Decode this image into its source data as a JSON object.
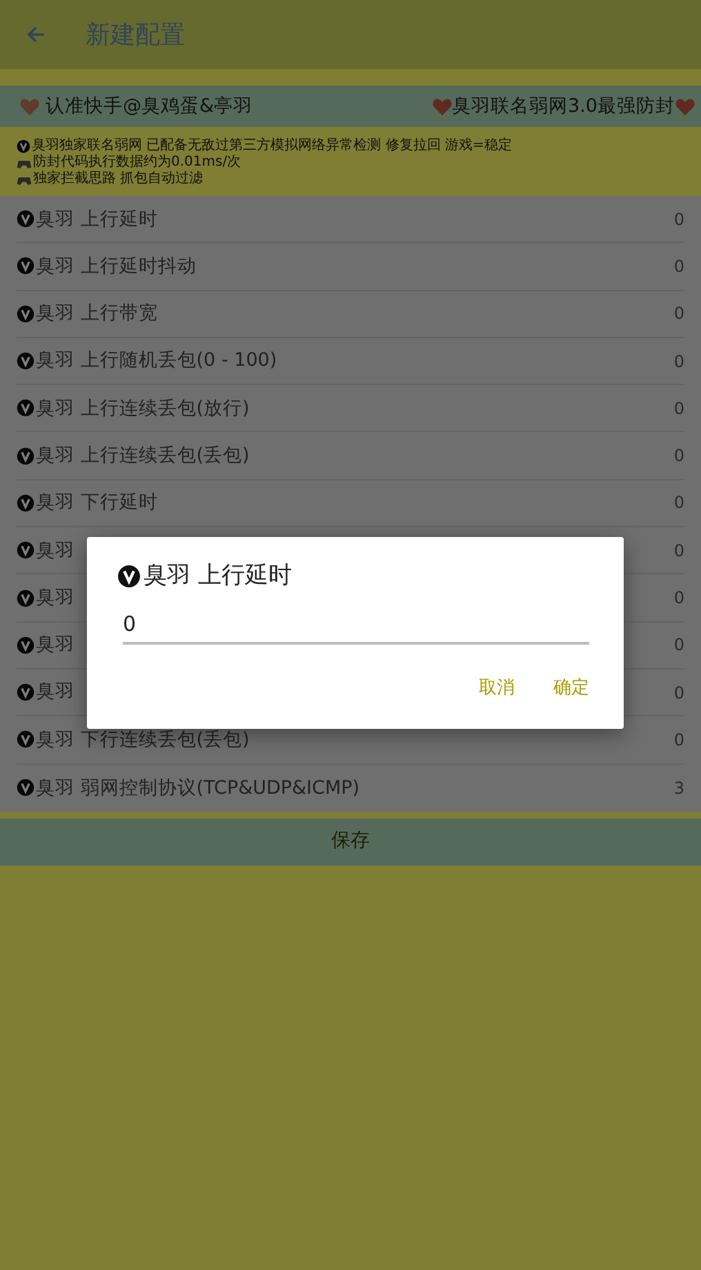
{
  "app_bar": {
    "title": "新建配置"
  },
  "banner": {
    "left": "认准快手@臭鸡蛋&亭羽",
    "right": "臭羽联名弱网3.0最强防封"
  },
  "notice": [
    "臭羽独家联名弱网 已配备无敌过第三方模拟网络异常检测 修复拉回 游戏=稳定",
    "防封代码执行数据约为0.01ms/次",
    "独家拦截思路 抓包自动过滤"
  ],
  "settings": [
    {
      "label": "臭羽 上行延时",
      "value": "0"
    },
    {
      "label": "臭羽 上行延时抖动",
      "value": "0"
    },
    {
      "label": "臭羽 上行带宽",
      "value": "0"
    },
    {
      "label": "臭羽 上行随机丢包(0 - 100)",
      "value": "0"
    },
    {
      "label": "臭羽 上行连续丢包(放行)",
      "value": "0"
    },
    {
      "label": "臭羽 上行连续丢包(丢包)",
      "value": "0"
    },
    {
      "label": "臭羽 下行延时",
      "value": "0"
    },
    {
      "label": "臭羽",
      "value": "0"
    },
    {
      "label": "臭羽",
      "value": "0"
    },
    {
      "label": "臭羽",
      "value": "0"
    },
    {
      "label": "臭羽",
      "value": "0"
    },
    {
      "label": "臭羽 下行连续丢包(丢包)",
      "value": "0"
    },
    {
      "label": "臭羽 弱网控制协议(TCP&UDP&ICMP)",
      "value": "3"
    }
  ],
  "save_button": "保存",
  "dialog": {
    "title": "臭羽 上行延时",
    "value": "0",
    "buttons": [
      "取消",
      "确定"
    ]
  }
}
